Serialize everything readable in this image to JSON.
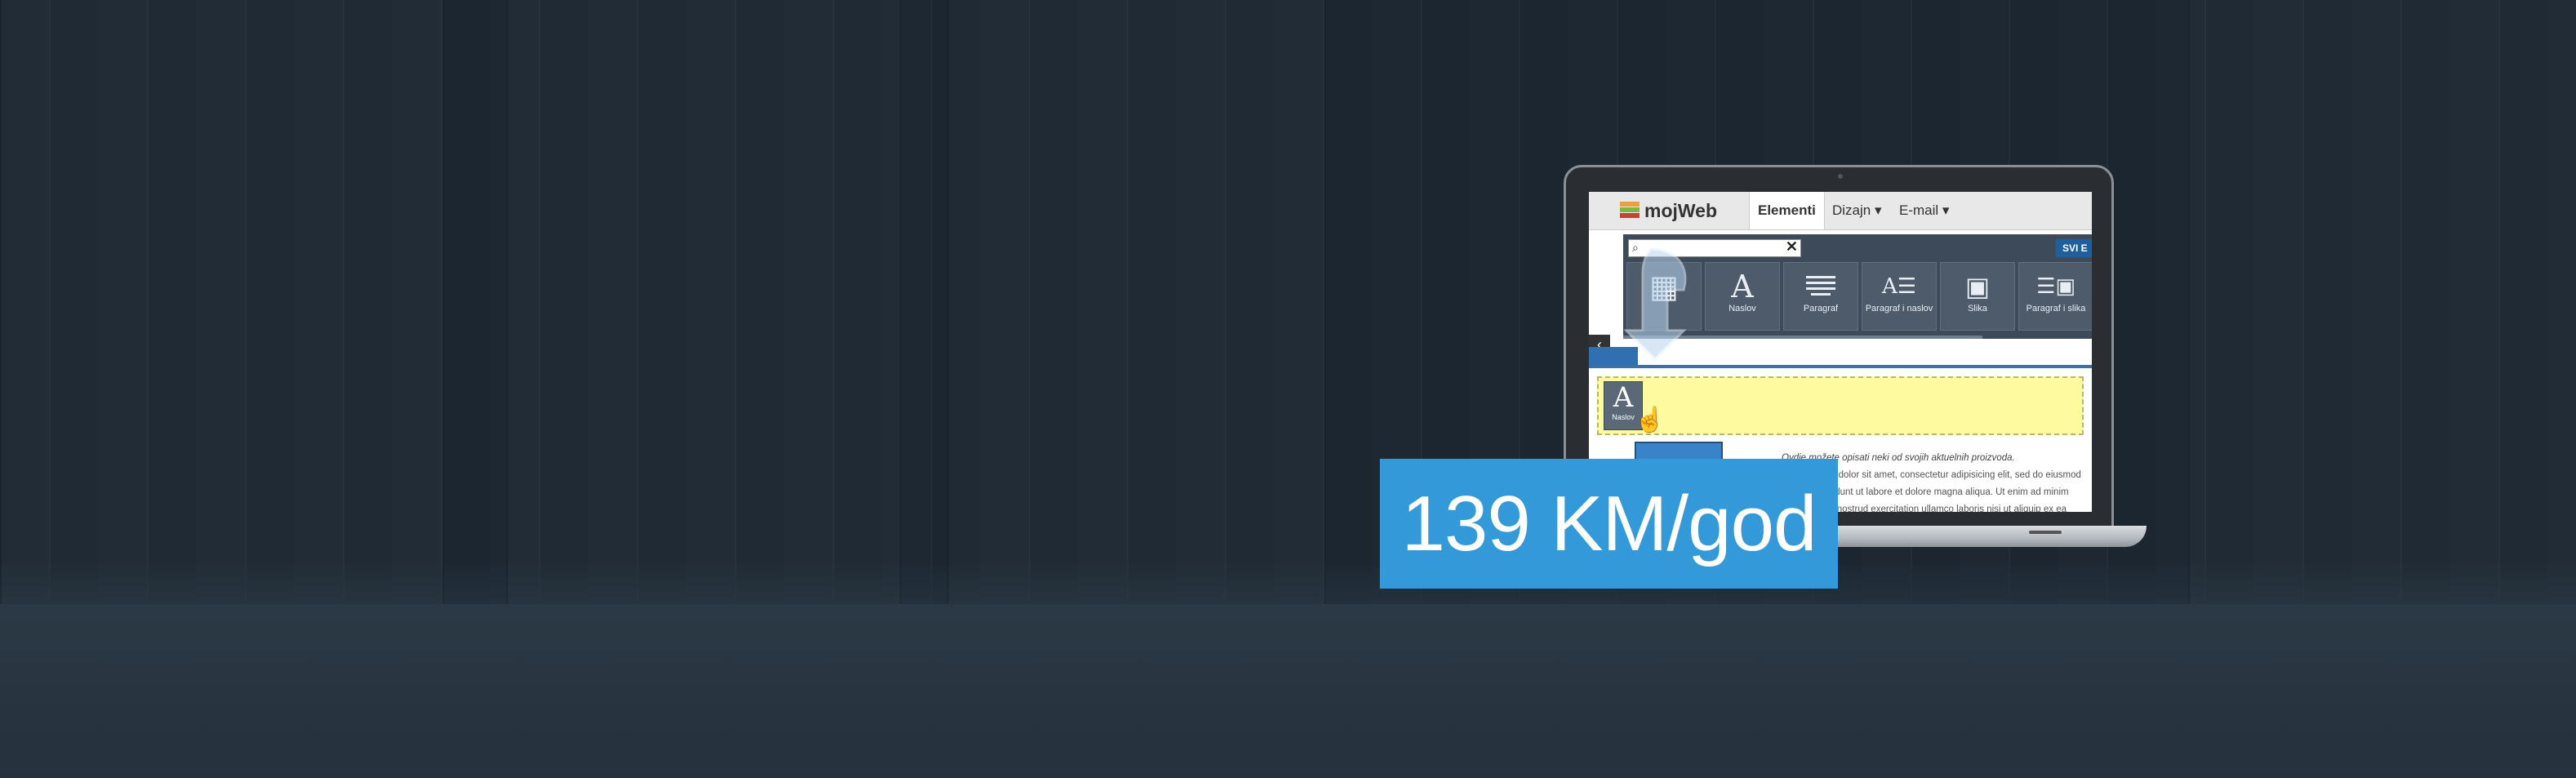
{
  "app": {
    "brand": "mojWeb",
    "tabs": [
      {
        "label": "Elementi",
        "active": true
      },
      {
        "label": "Dizajn ▾",
        "active": false
      },
      {
        "label": "E-mail ▾",
        "active": false
      }
    ]
  },
  "palette": {
    "search_placeholder": "",
    "svi_label": "SVI E",
    "tools": [
      {
        "label": "",
        "icon": "grid-icon"
      },
      {
        "label": "Naslov",
        "icon": "heading-icon"
      },
      {
        "label": "Paragraf",
        "icon": "paragraph-icon"
      },
      {
        "label": "Paragraf i naslov",
        "icon": "paragraph-heading-icon"
      },
      {
        "label": "Slika",
        "icon": "image-icon"
      },
      {
        "label": "Paragraf i slika",
        "icon": "paragraph-image-icon"
      }
    ]
  },
  "editor": {
    "drag_tile_label": "Naslov",
    "intro_text": "Ovdje možete opisati neki od svojih aktuelnih proizvoda.",
    "body_text": "Lorem ipsum dolor sit amet, consectetur adipisicing elit, sed do eiusmod tempor incididunt ut labore et dolore magna aliqua. Ut enim ad minim veniam, quis nostrud exercitation ullamco laboris nisi ut aliquip ex ea commodo consequat. Duis aute"
  },
  "price_banner": {
    "text": "139 KM/god",
    "color": "#3399d9"
  },
  "colors": {
    "background": "#1f2b37",
    "drop_zone": "#fdfaa0",
    "palette": "#3c4a59"
  }
}
